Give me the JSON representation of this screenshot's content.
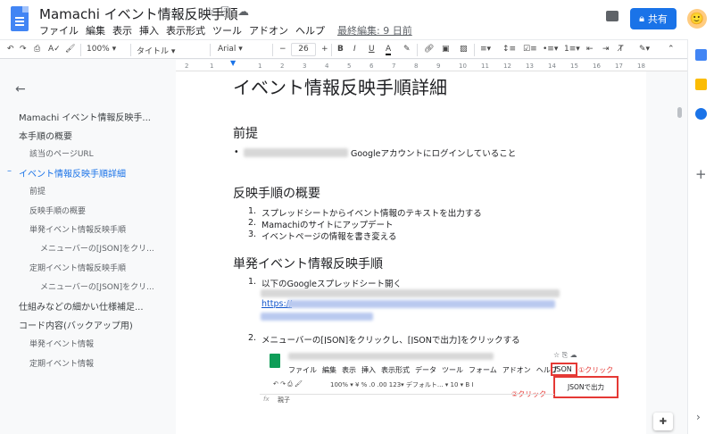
{
  "app": {
    "title": "Mamachi イベント情報反映手順",
    "star_icon": "☆",
    "folder_icon": "⎘",
    "cloud_icon": "☁"
  },
  "menu": [
    "ファイル",
    "編集",
    "表示",
    "挿入",
    "表示形式",
    "ツール",
    "アドオン",
    "ヘルプ"
  ],
  "last_edit": "最終編集: 9 日前",
  "share_label": "共有",
  "toolbar": {
    "zoom": "100%",
    "style": "タイトル",
    "font": "Arial",
    "font_size": "26",
    "bold": "B",
    "italic": "I",
    "underline": "U",
    "text_color": "A"
  },
  "ruler_ticks": [
    "2",
    "1",
    "1",
    "2",
    "3",
    "4",
    "5",
    "6",
    "7",
    "8",
    "9",
    "10",
    "11",
    "12",
    "13",
    "14",
    "15",
    "16",
    "17",
    "18"
  ],
  "outline": {
    "items": [
      {
        "label": "Mamachi イベント情報反映手...",
        "level": 1,
        "active": false
      },
      {
        "label": "本手順の概要",
        "level": 1,
        "active": false
      },
      {
        "label": "該当のページURL",
        "level": 2,
        "active": false
      },
      {
        "label": "イベント情報反映手順詳細",
        "level": 1,
        "active": true
      },
      {
        "label": "前提",
        "level": 2,
        "active": false
      },
      {
        "label": "反映手順の概要",
        "level": 2,
        "active": false
      },
      {
        "label": "単発イベント情報反映手順",
        "level": 2,
        "active": false
      },
      {
        "label": "メニューバーの[JSON]をクリ...",
        "level": 3,
        "active": false
      },
      {
        "label": "定期イベント情報反映手順",
        "level": 2,
        "active": false
      },
      {
        "label": "メニューバーの[JSON]をクリ...",
        "level": 3,
        "active": false
      },
      {
        "label": "仕組みなどの細かい仕様補足...",
        "level": 1,
        "active": false
      },
      {
        "label": "コード内容(バックアップ用)",
        "level": 1,
        "active": false
      },
      {
        "label": "単発イベント情報",
        "level": 2,
        "active": false
      },
      {
        "label": "定期イベント情報",
        "level": 2,
        "active": false
      }
    ]
  },
  "doc": {
    "h1": "イベント情報反映手順詳細",
    "premise_heading": "前提",
    "premise_text": "Googleアカウントにログインしていること",
    "overview_heading": "反映手順の概要",
    "overview_items": [
      "スプレッドシートからイベント情報のテキストを出力する",
      "Mamachiのサイトにアップデート",
      "イベントページの情報を書き変える"
    ],
    "single_heading": "単発イベント情報反映手順",
    "step1": "以下のGoogleスプレッドシート開く",
    "step1_link": "https://",
    "step2": "メニューバーの[JSON]をクリックし、[JSONで出力]をクリックする"
  },
  "embed": {
    "menu": [
      "ファイル",
      "編集",
      "表示",
      "挿入",
      "表示形式",
      "データ",
      "ツール",
      "フォーム",
      "アドオン",
      "ヘルプ"
    ],
    "json_label": "JSON",
    "click1": "①クリック",
    "json_output": "JSONで出力",
    "click2": "②クリック",
    "toolbar_text": "100%  ▾   ¥   %   .0  .00  123▾   デフォルト...  ▾   10   ▾   B   I",
    "fx_value": "親子"
  },
  "colors": {
    "accent": "#1a73e8",
    "red": "#e53935",
    "sheets_green": "#0f9d58"
  }
}
